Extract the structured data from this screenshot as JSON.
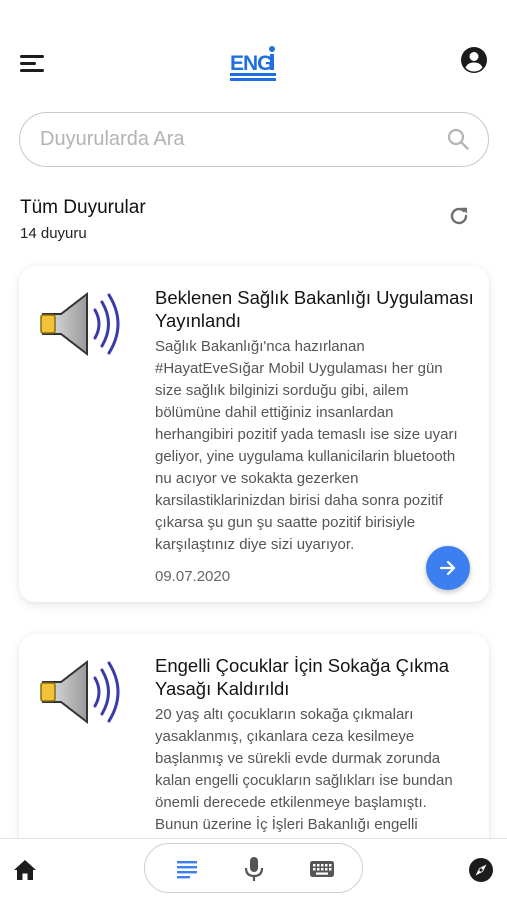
{
  "header": {
    "logo_text": "ENGi",
    "menu_icon": "menu-icon",
    "profile_icon": "account-circle-icon"
  },
  "search": {
    "placeholder": "Duyurularda Ara",
    "value": ""
  },
  "section": {
    "title": "Tüm Duyurular",
    "count": "14 duyuru"
  },
  "announcements": [
    {
      "icon": "speaker-icon",
      "title": "Beklenen Sağlık Bakanlığı Uygulaması Yayınlandı",
      "body": "Sağlık Bakanlığı'nca hazırlanan #HayatEveSığar Mobil Uygulaması her gün size sağlık bilginizi sorduğu gibi, ailem bölümüne dahil ettiğiniz insanlardan herhangibiri pozitif yada temaslı ise size uyarı geliyor, yine uygulama kullanicilarin bluetooth nu acıyor ve sokakta gezerken karsilastiklarinizdan birisi daha sonra pozitif çıkarsa şu gun şu saatte pozitif birisiyle karşılaştınız diye sizi uyarıyor.",
      "date": "09.07.2020"
    },
    {
      "icon": "speaker-icon",
      "title": "Engelli Çocuklar İçin Sokağa Çıkma Yasağı Kaldırıldı",
      "body": "20 yaş altı çocukların sokağa çıkmaları yasaklanmış, çıkanlara ceza kesilmeye başlanmış ve sürekli evde durmak zorunda kalan engelli çocukların sağlıkları ise bundan önemli derecede etkilenmeye başlamıştı. Bunun üzerine İç İşleri Bakanlığı engelli çocukların sokağa çıkma yasağını kaldırdı.",
      "date": ""
    }
  ],
  "bottom_nav": {
    "home_icon": "home-icon",
    "text_icon": "text-lines-icon",
    "mic_icon": "microphone-icon",
    "keyboard_icon": "keyboard-icon",
    "compass_icon": "compass-icon"
  },
  "colors": {
    "accent": "#3c7ff0",
    "logo": "#1f6fe0",
    "text_primary": "#141414",
    "text_secondary": "#555555"
  }
}
